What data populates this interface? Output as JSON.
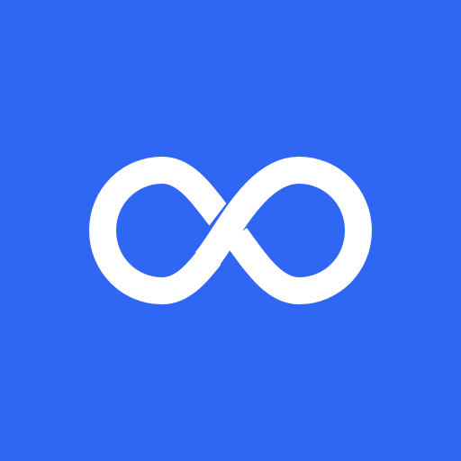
{
  "icon": {
    "name": "infinity-icon",
    "background_color": "#2F66F3",
    "symbol_color": "#FFFFFF"
  }
}
